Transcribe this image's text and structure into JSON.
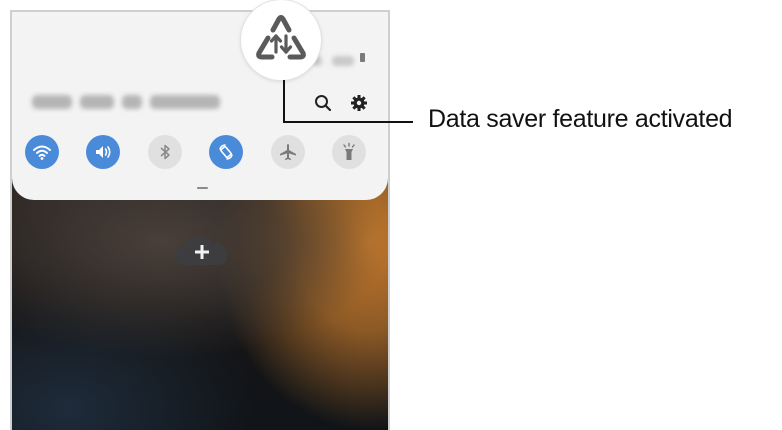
{
  "caption": {
    "text": "Data saver feature activated"
  },
  "icons": {
    "zoomed_status_icon": "data-saver-icon",
    "panel": [
      "search-icon",
      "gear-icon"
    ],
    "add_button": "plus-cloud-icon"
  },
  "quick_settings": {
    "tiles": [
      {
        "icon": "wifi-icon",
        "state": "on"
      },
      {
        "icon": "sound-icon",
        "state": "on"
      },
      {
        "icon": "bluetooth-icon",
        "state": "off"
      },
      {
        "icon": "auto-rotate-icon",
        "state": "on"
      },
      {
        "icon": "airplane-icon",
        "state": "off"
      },
      {
        "icon": "flashlight-icon",
        "state": "off"
      }
    ]
  },
  "colors": {
    "tile_on": "#4a8bd9",
    "tile_off": "#e0e0e0",
    "panel_bg": "#f3f3f3",
    "leader_line": "#111111"
  }
}
